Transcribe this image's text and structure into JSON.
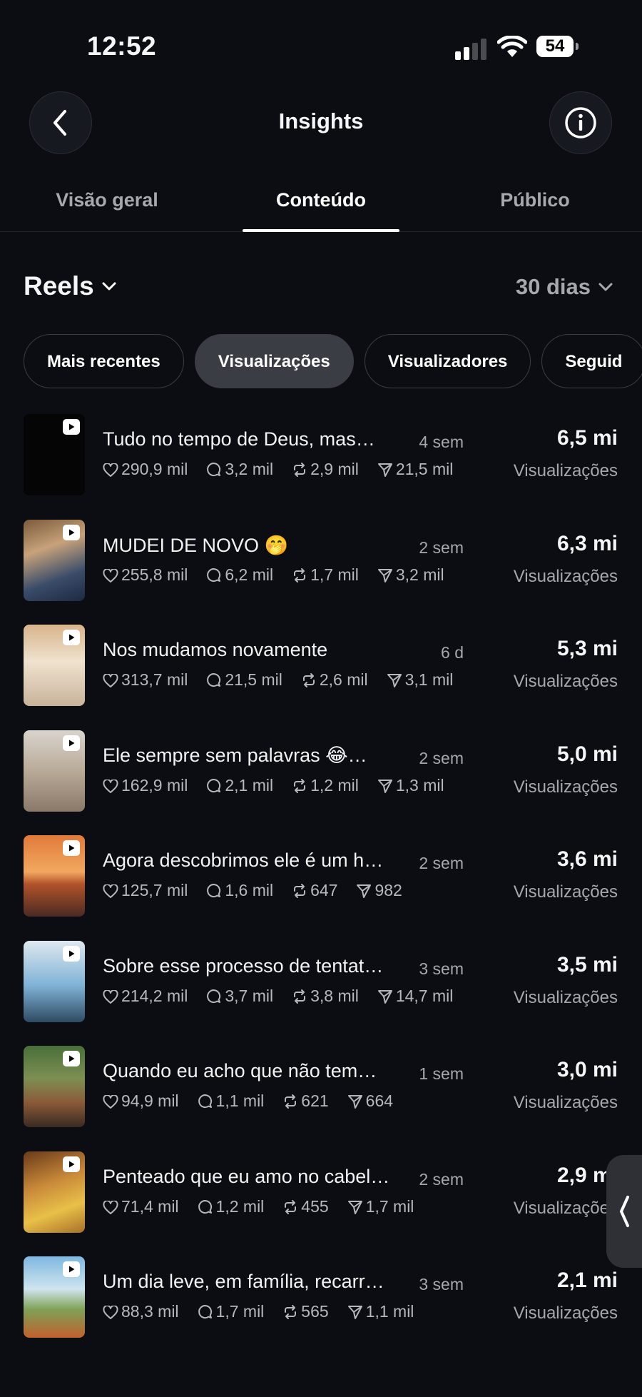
{
  "status_bar": {
    "time": "12:52",
    "battery": "54"
  },
  "header": {
    "title": "Insights"
  },
  "tabs": [
    {
      "label": "Visão geral"
    },
    {
      "label": "Conteúdo"
    },
    {
      "label": "Público"
    }
  ],
  "section": {
    "title": "Reels",
    "period": "30 dias"
  },
  "filters": [
    {
      "label": "Mais recentes"
    },
    {
      "label": "Visualizações"
    },
    {
      "label": "Visualizadores"
    },
    {
      "label": "Seguid"
    }
  ],
  "value_label": "Visualizações",
  "reels": [
    {
      "title": "Tudo no tempo de Deus, mas…",
      "age": "4 sem",
      "likes": "290,9 mil",
      "comments": "3,2 mil",
      "reposts": "2,9 mil",
      "shares": "21,5 mil",
      "value": "6,5 mi"
    },
    {
      "title": "MUDEI DE NOVO 🤭",
      "age": "2 sem",
      "likes": "255,8 mil",
      "comments": "6,2 mil",
      "reposts": "1,7 mil",
      "shares": "3,2 mil",
      "value": "6,3 mi"
    },
    {
      "title": "Nos mudamos novamente",
      "age": "6 d",
      "likes": "313,7 mil",
      "comments": "21,5 mil",
      "reposts": "2,6 mil",
      "shares": "3,1 mil",
      "value": "5,3 mi"
    },
    {
      "title": "Ele sempre sem palavras 😂…",
      "age": "2 sem",
      "likes": "162,9 mil",
      "comments": "2,1 mil",
      "reposts": "1,2 mil",
      "shares": "1,3 mil",
      "value": "5,0 mi"
    },
    {
      "title": "Agora descobrimos ele é um h…",
      "age": "2 sem",
      "likes": "125,7 mil",
      "comments": "1,6 mil",
      "reposts": "647",
      "shares": "982",
      "value": "3,6 mi"
    },
    {
      "title": "Sobre esse processo de tentat…",
      "age": "3 sem",
      "likes": "214,2 mil",
      "comments": "3,7 mil",
      "reposts": "3,8 mil",
      "shares": "14,7 mil",
      "value": "3,5 mi"
    },
    {
      "title": "Quando eu acho que não tem…",
      "age": "1 sem",
      "likes": "94,9 mil",
      "comments": "1,1 mil",
      "reposts": "621",
      "shares": "664",
      "value": "3,0 mi"
    },
    {
      "title": "Penteado que eu amo no cabel…",
      "age": "2 sem",
      "likes": "71,4 mil",
      "comments": "1,2 mil",
      "reposts": "455",
      "shares": "1,7 mil",
      "value": "2,9 mi"
    },
    {
      "title": "Um dia leve, em família, recarr…",
      "age": "3 sem",
      "likes": "88,3 mil",
      "comments": "1,7 mil",
      "reposts": "565",
      "shares": "1,1 mil",
      "value": "2,1 mi"
    }
  ],
  "icons": {
    "back": "chevron-left-icon",
    "info": "info-icon",
    "dropdown": "chevron-down-icon",
    "like": "heart-icon",
    "comment": "comment-icon",
    "repost": "repost-icon",
    "share": "send-icon",
    "reel": "reel-play-icon"
  }
}
